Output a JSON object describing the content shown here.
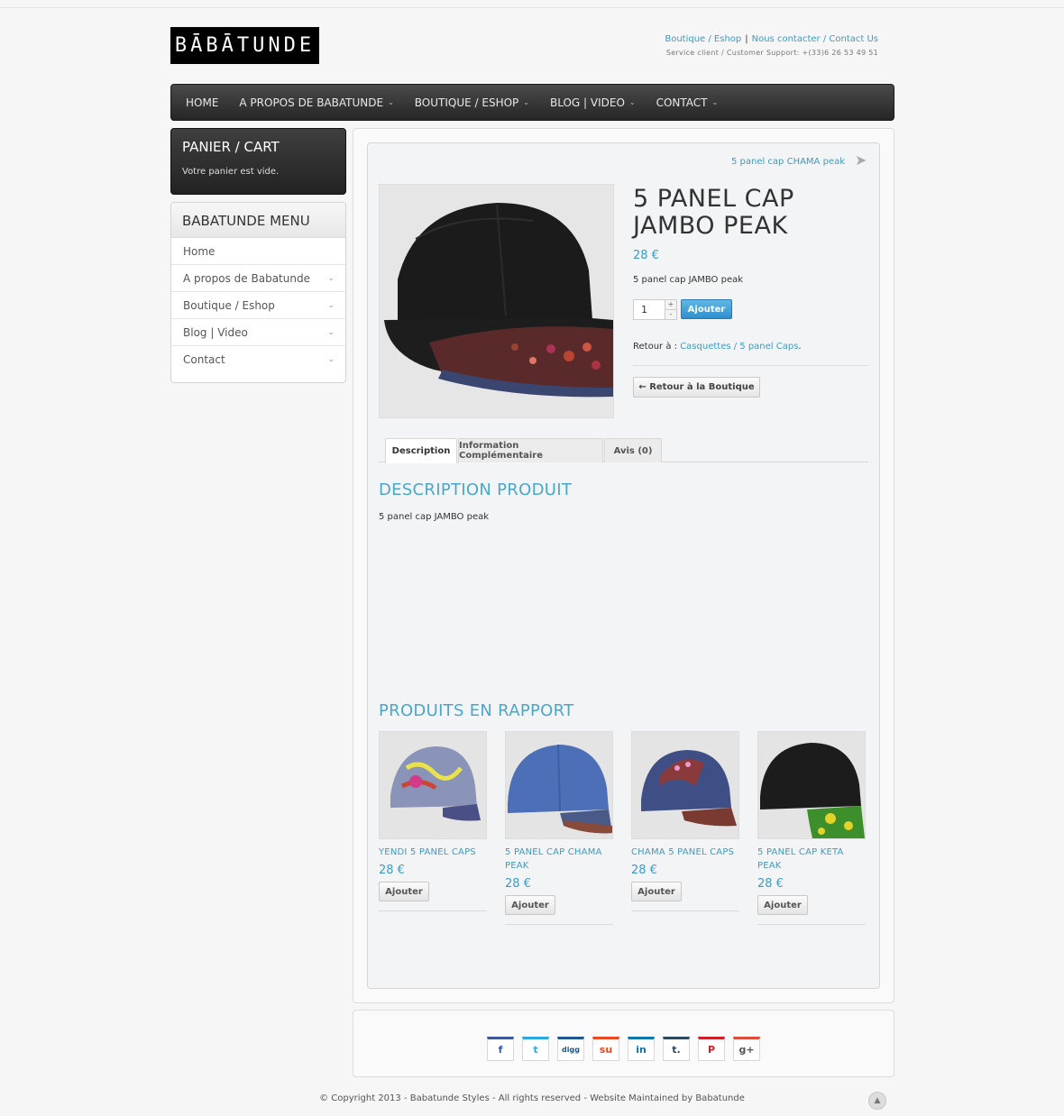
{
  "brand": {
    "logo_text": "BĀBĀTUNDE"
  },
  "header": {
    "link_shop": "Boutique / Eshop",
    "separator": "|",
    "link_contact": "Nous contacter / Contact Us",
    "support": "Service client / Customer Support: +(33)6 26 53 49 51"
  },
  "nav": {
    "items": [
      {
        "label": "HOME",
        "dropdown": false
      },
      {
        "label": "A PROPOS DE BABATUNDE",
        "dropdown": true
      },
      {
        "label": "BOUTIQUE / ESHOP",
        "dropdown": true
      },
      {
        "label": "BLOG | VIDEO",
        "dropdown": true
      },
      {
        "label": "CONTACT",
        "dropdown": true
      }
    ]
  },
  "cart": {
    "title": "PANIER / CART",
    "empty_text": "Votre panier est vide."
  },
  "menu": {
    "title": "BABATUNDE MENU",
    "items": [
      {
        "label": "Home"
      },
      {
        "label": "A propos de Babatunde"
      },
      {
        "label": "Boutique / Eshop"
      },
      {
        "label": "Blog | Video"
      },
      {
        "label": "Contact"
      }
    ]
  },
  "product": {
    "next_link": "5 panel cap CHAMA peak",
    "title": "5 PANEL CAP JAMBO PEAK",
    "price": "28 €",
    "short_desc": "5 panel cap JAMBO peak",
    "qty": "1",
    "qty_plus": "+",
    "qty_minus": "-",
    "add_label": "Ajouter",
    "retour_prefix": "Retour à : ",
    "retour_link": "Casquettes / 5 panel Caps",
    "retour_suffix": ".",
    "back_label": "← Retour à la Boutique"
  },
  "tabs": [
    {
      "label": "Description"
    },
    {
      "label": "Information Complémentaire"
    },
    {
      "label": "Avis (0)"
    }
  ],
  "description": {
    "heading": "DESCRIPTION PRODUIT",
    "text": "5 panel cap JAMBO peak"
  },
  "related": {
    "heading": "PRODUITS EN RAPPORT",
    "items": [
      {
        "name": "YENDI 5 PANEL CAPS",
        "price": "28 €",
        "button": "Ajouter",
        "cap_color": "#8a93b8"
      },
      {
        "name": "5 PANEL CAP CHAMA PEAK",
        "price": "28 €",
        "button": "Ajouter",
        "cap_color": "#4d6fb8"
      },
      {
        "name": "CHAMA 5 PANEL CAPS",
        "price": "28 €",
        "button": "Ajouter",
        "cap_color": "#3f4f86"
      },
      {
        "name": "5 PANEL CAP KETA PEAK",
        "price": "28 €",
        "button": "Ajouter",
        "cap_color": "#1c1c1c"
      }
    ]
  },
  "share": [
    {
      "label": "f",
      "icon": "facebook-icon",
      "color": "#3b5998"
    },
    {
      "label": "t",
      "icon": "twitter-icon",
      "color": "#2aa9e0"
    },
    {
      "label": "digg",
      "icon": "digg-icon",
      "color": "#1b5891"
    },
    {
      "label": "su",
      "icon": "stumbleupon-icon",
      "color": "#eb4823"
    },
    {
      "label": "in",
      "icon": "linkedin-icon",
      "color": "#0e76a8"
    },
    {
      "label": "t.",
      "icon": "tumblr-icon",
      "color": "#2c4762"
    },
    {
      "label": "P",
      "icon": "pinterest-icon",
      "color": "#cb2027"
    },
    {
      "label": "g+",
      "icon": "googleplus-icon",
      "color": "#dd4b39"
    }
  ],
  "footer": {
    "text": "© Copyright 2013 - Babatunde Styles - All rights reserved - Website Maintained by Babatunde",
    "top_icon": "▲"
  },
  "colors": {
    "accent": "#3d9bc3",
    "nav_dark": "#2a2a2a"
  }
}
